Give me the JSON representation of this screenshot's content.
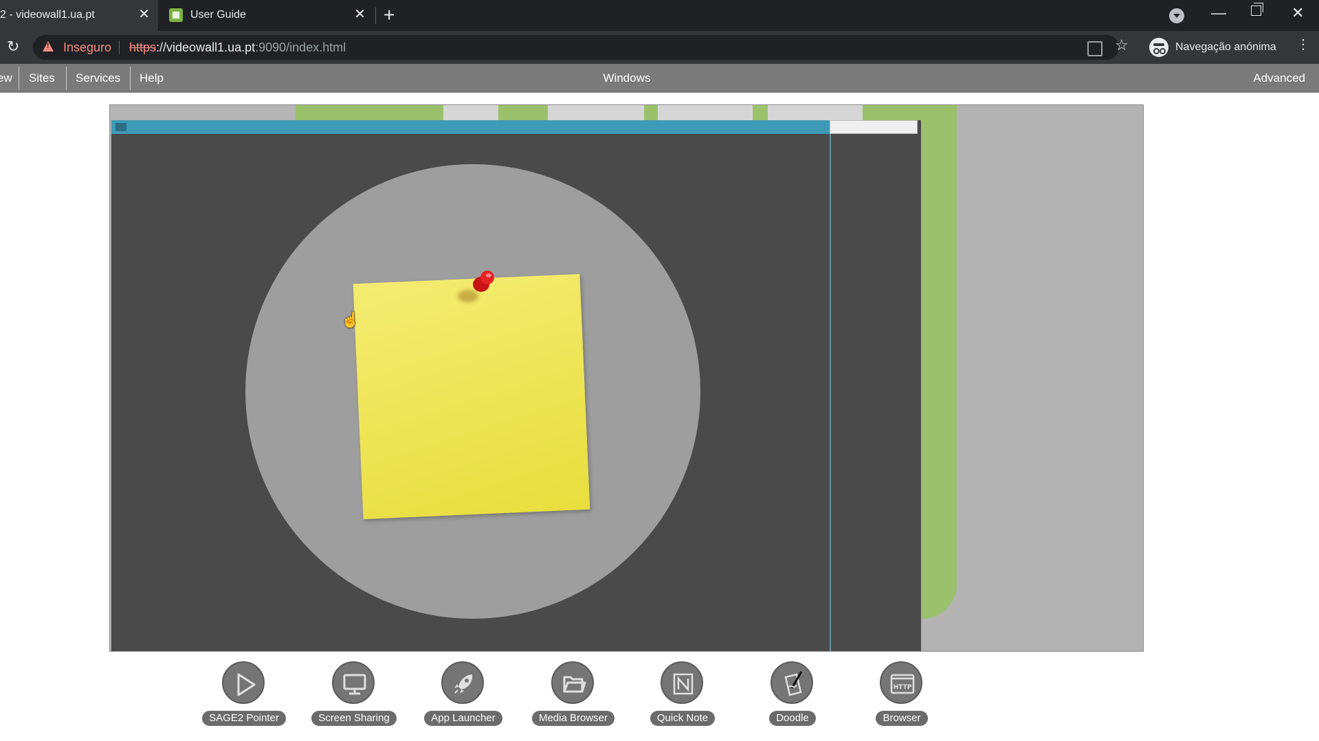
{
  "browser": {
    "tabs": [
      {
        "title": "2 - videowall1.ua.pt",
        "active": true
      },
      {
        "title": "User Guide",
        "active": false
      }
    ],
    "address": {
      "security_label": "Inseguro",
      "url_scheme": "https",
      "url_host": "://videowall1.ua.pt",
      "url_path": ":9090/index.html"
    },
    "profile_label": "Navegação anónima"
  },
  "nav": {
    "left_items": [
      "ew",
      "Sites",
      "Services",
      "Help"
    ],
    "center_title": "Windows",
    "right_item": "Advanced"
  },
  "toolbar": {
    "items": [
      {
        "label": "SAGE2 Pointer",
        "icon": "pointer-icon"
      },
      {
        "label": "Screen Sharing",
        "icon": "monitor-icon"
      },
      {
        "label": "App Launcher",
        "icon": "rocket-icon"
      },
      {
        "label": "Media Browser",
        "icon": "folder-icon"
      },
      {
        "label": "Quick Note",
        "icon": "note-icon"
      },
      {
        "label": "Doodle",
        "icon": "doodle-icon"
      },
      {
        "label": "Browser",
        "icon": "http-icon"
      }
    ]
  },
  "colors": {
    "titlebar": "#3f9bb5",
    "green_accent": "#9bc16d",
    "note_yellow": "#f0e85a",
    "pin_red": "#e02020"
  }
}
